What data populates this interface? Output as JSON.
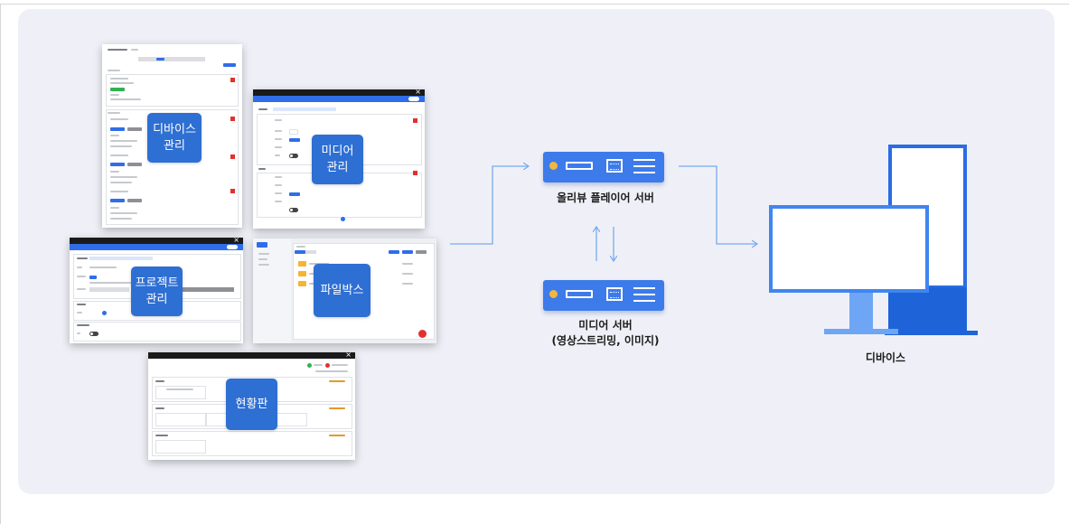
{
  "labels": {
    "device_mgmt": "디바이스\n관리",
    "media_mgmt": "미디어\n관리",
    "project_mgmt": "프로젝트\n관리",
    "file_box": "파일박스",
    "dashboard": "현황판"
  },
  "servers": {
    "player_server": "올리뷰 플레이어 서버",
    "media_server_line1": "미디어 서버",
    "media_server_line2": "(영상스트리밍, 이미지)"
  },
  "devices": {
    "label": "디바이스"
  },
  "icons": [
    "server-icon",
    "monitor-icon",
    "kiosk-icon",
    "close-icon",
    "folder-icon"
  ],
  "colors": {
    "panel_bg": "#eff0f7",
    "accent_blue": "#2e6fd3",
    "server_blue": "#3d7bea",
    "connector": "#78aaf0",
    "monitor_blue": "#3f86f0"
  }
}
